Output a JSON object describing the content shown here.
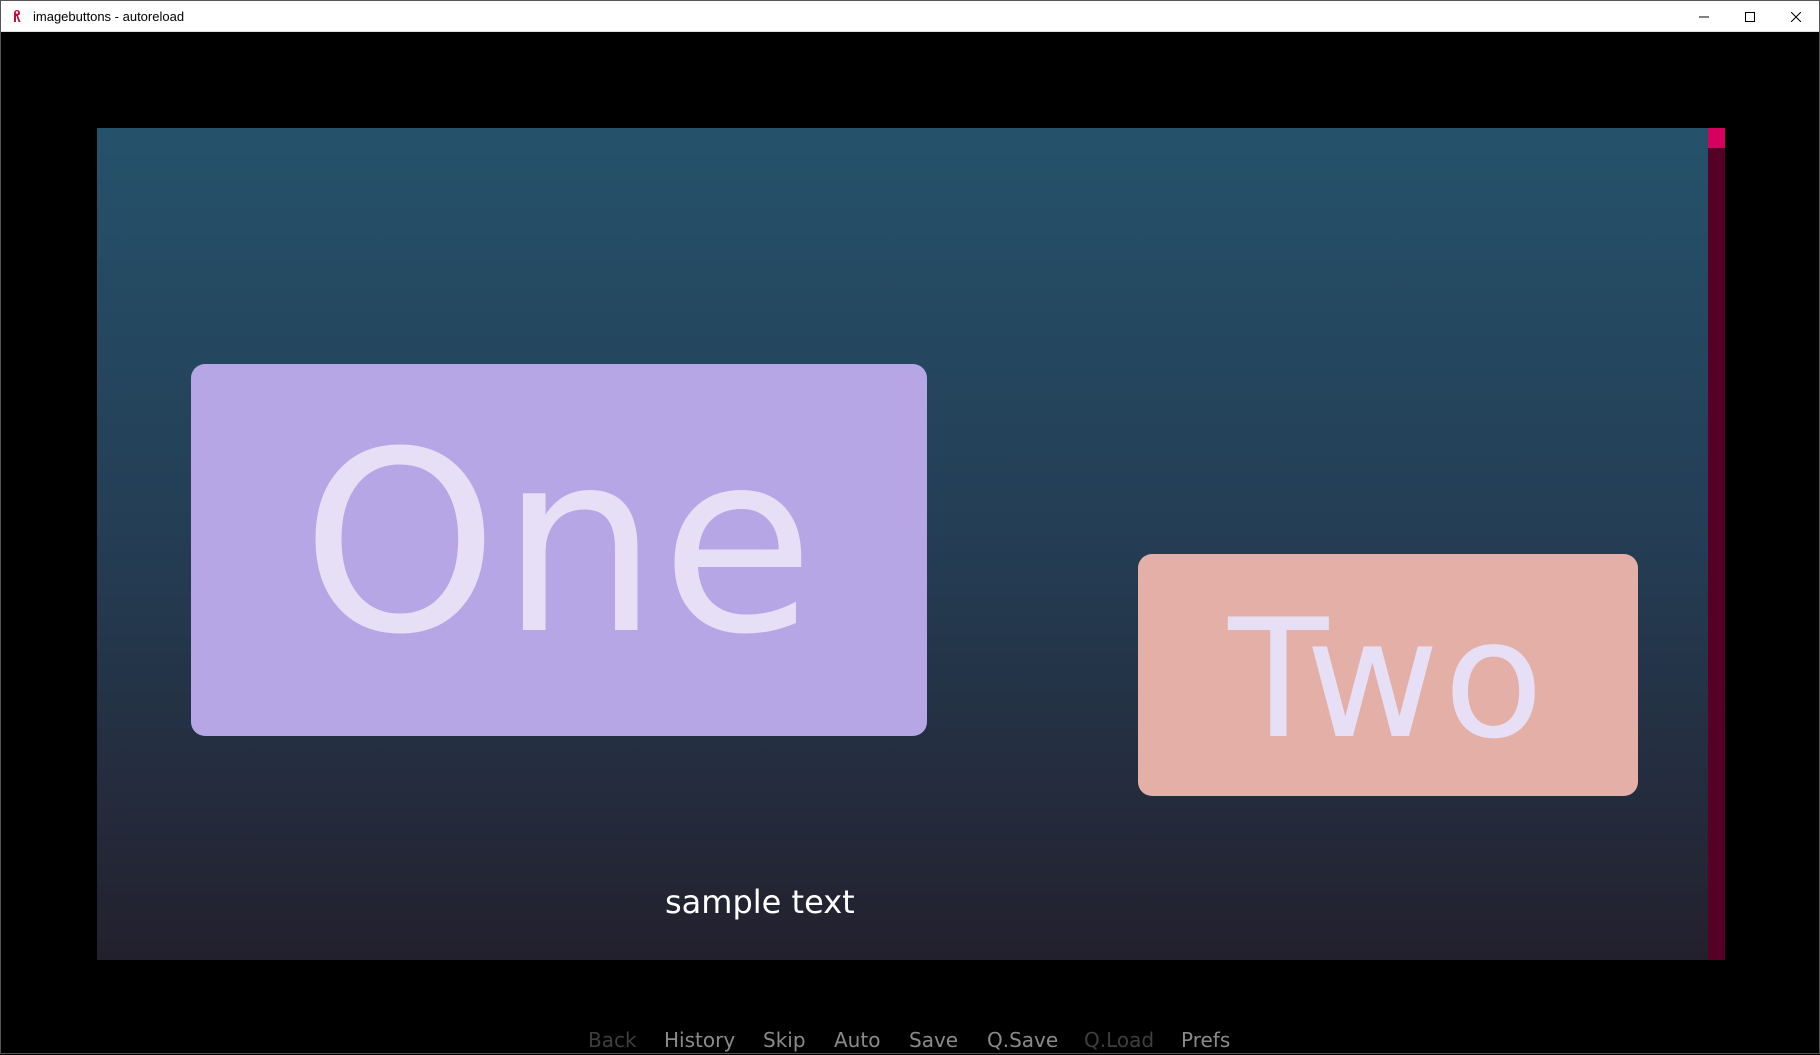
{
  "window": {
    "title": "imagebuttons - autoreload",
    "controls": {
      "minimize": "─",
      "maximize": "☐",
      "close": "✕"
    }
  },
  "game": {
    "buttons": {
      "one": "One",
      "two": "Two"
    },
    "sample_text": "sample text"
  },
  "quick_menu": {
    "items": [
      {
        "label": "Back",
        "enabled": false
      },
      {
        "label": "History",
        "enabled": true
      },
      {
        "label": "Skip",
        "enabled": true
      },
      {
        "label": "Auto",
        "enabled": true
      },
      {
        "label": "Save",
        "enabled": true
      },
      {
        "label": "Q.Save",
        "enabled": true
      },
      {
        "label": "Q.Load",
        "enabled": false
      },
      {
        "label": "Prefs",
        "enabled": true
      }
    ]
  },
  "colors": {
    "button_one": "#b6a6e5",
    "button_two": "#e4afa6",
    "button_text": "#e6dff5",
    "scrollbar_track": "#570026",
    "scrollbar_thumb": "#d6005f"
  }
}
